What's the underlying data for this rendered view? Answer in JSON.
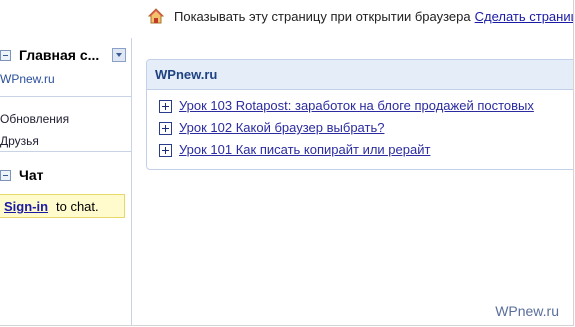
{
  "topbar": {
    "icon": "home-icon",
    "text": "Показывать эту страницу при открытии браузера",
    "link": "Сделать страниц"
  },
  "sidebar": {
    "main_section": {
      "title": "Главная с...",
      "site_link": "WPnew.ru",
      "items": [
        {
          "label": "Обновления"
        },
        {
          "label": "Друзья"
        }
      ]
    },
    "chat_section": {
      "title": "Чат",
      "signin_link": "Sign-in",
      "signin_rest": "to chat."
    }
  },
  "main": {
    "panel": {
      "title": "WPnew.ru",
      "items": [
        {
          "label": "Урок 103 Rotapost: заработок на блоге продажей постовых"
        },
        {
          "label": "Урок 102 Какой браузер выбрать?"
        },
        {
          "label": "Урок 101 Как писать копирайт или рерайт"
        }
      ]
    }
  },
  "watermark": "WPnew.ru"
}
